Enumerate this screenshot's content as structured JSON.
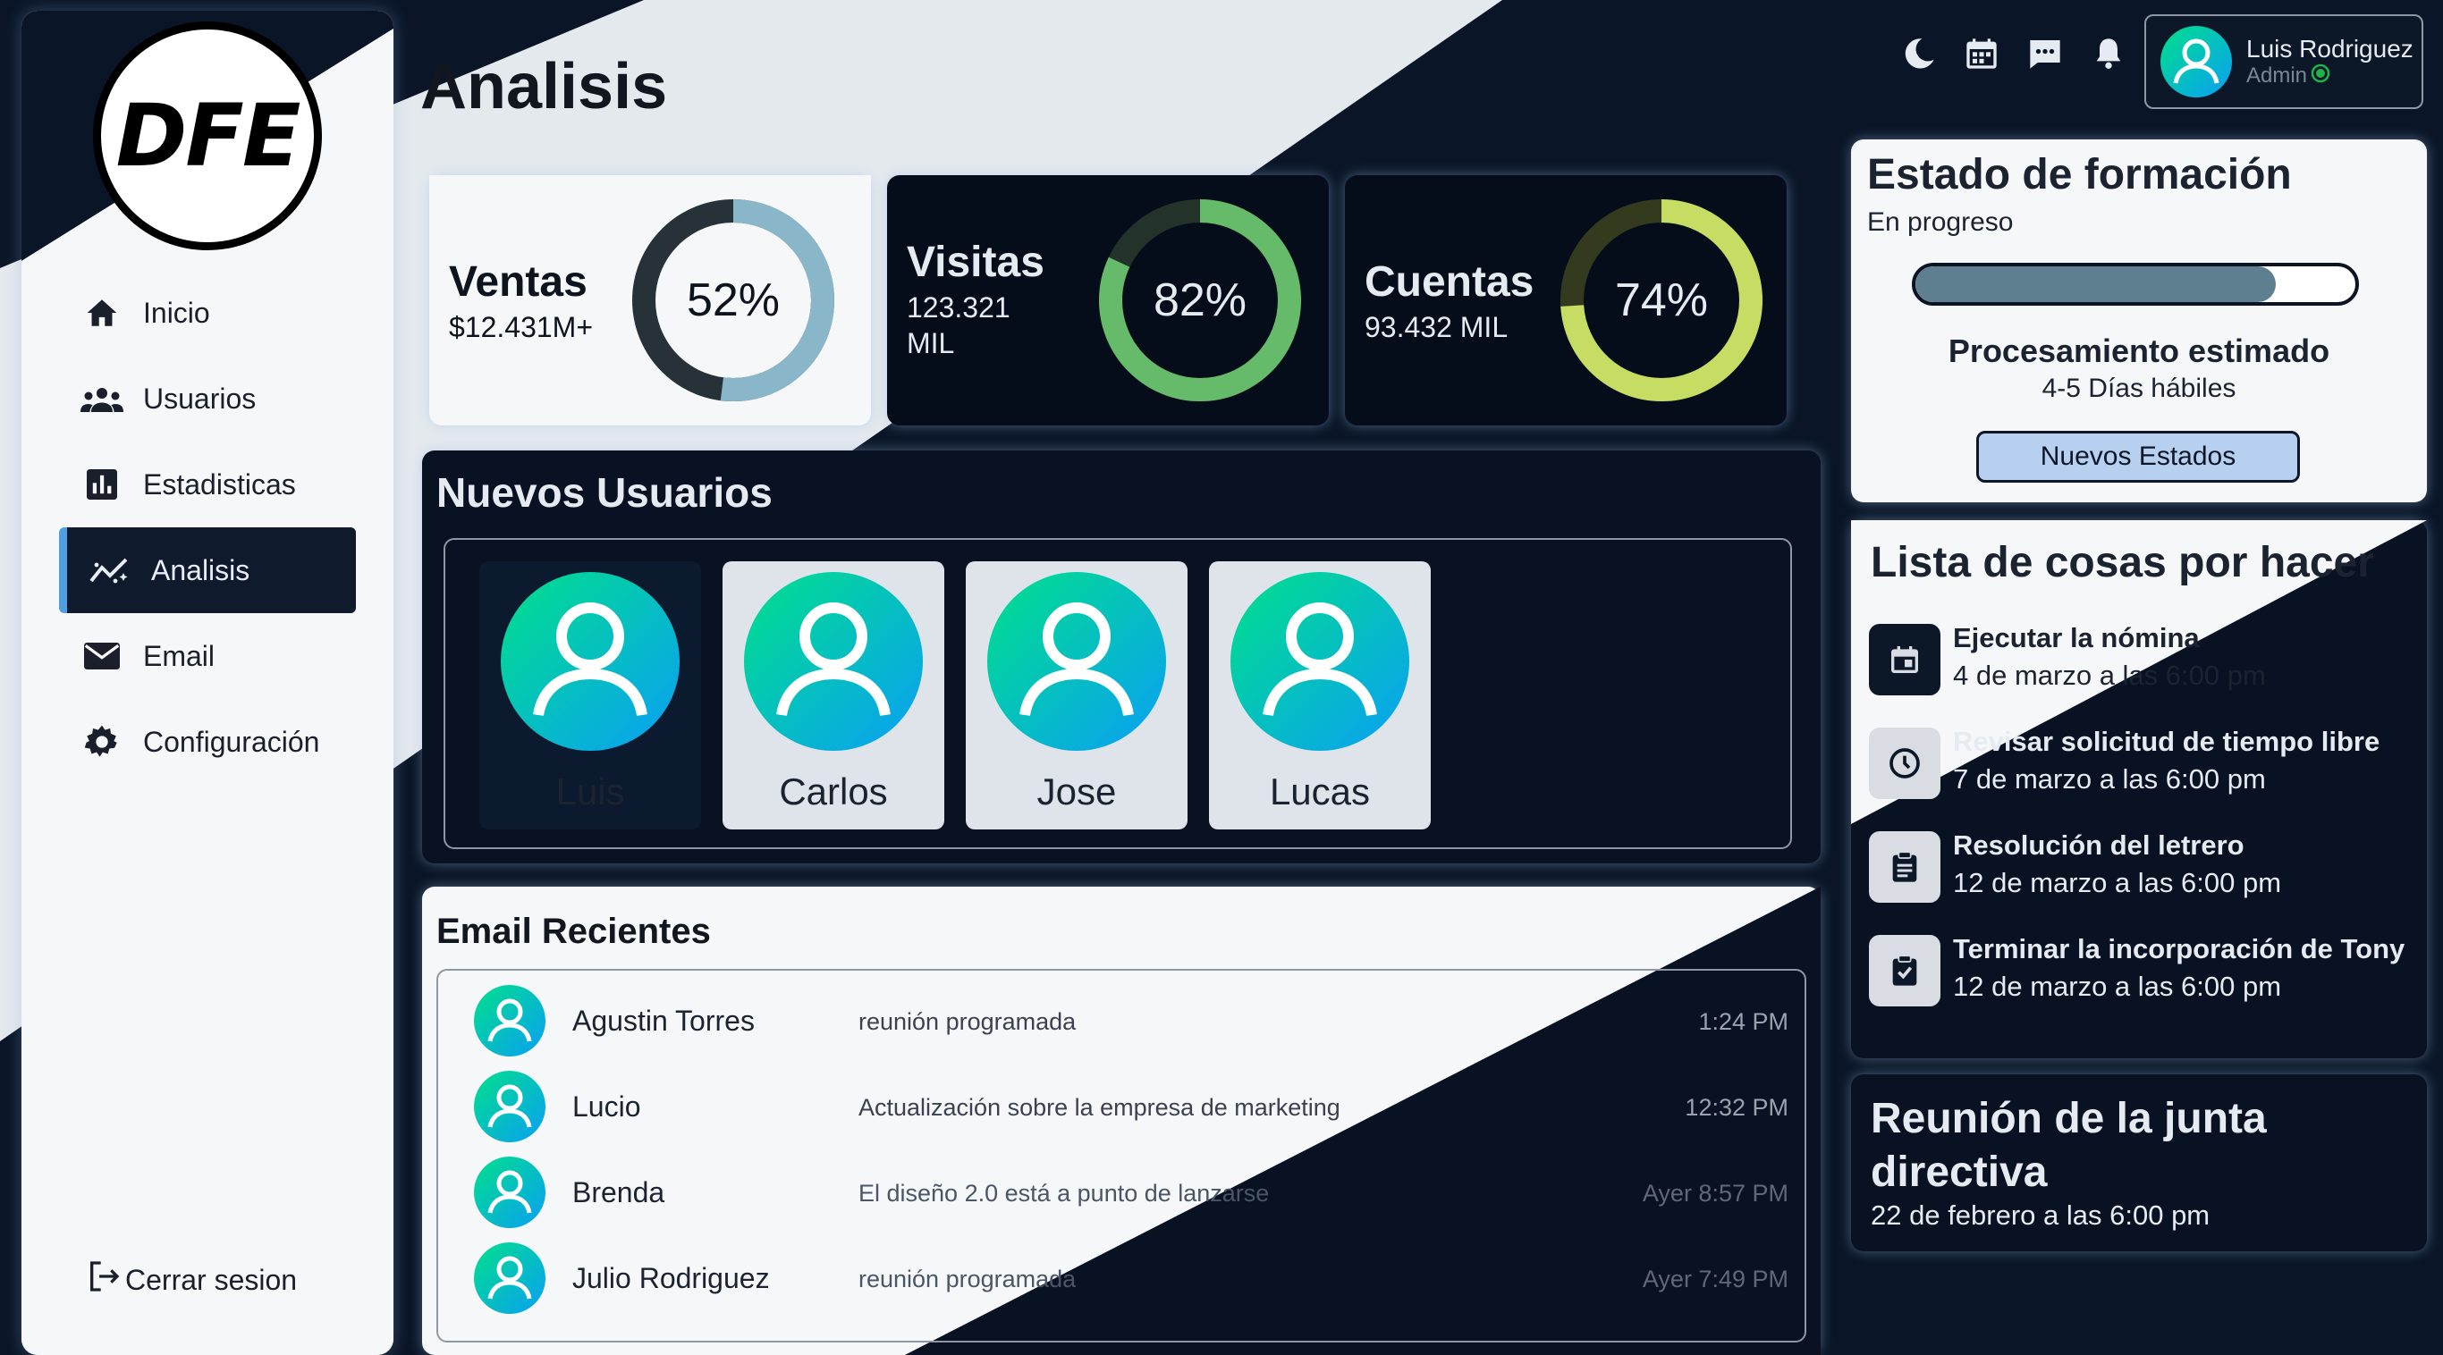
{
  "sidebar": {
    "logo_text": "DFE",
    "items": [
      {
        "label": "Inicio",
        "icon": "home-icon"
      },
      {
        "label": "Usuarios",
        "icon": "users-icon"
      },
      {
        "label": "Estadisticas",
        "icon": "bar-chart-icon"
      },
      {
        "label": "Analisis",
        "icon": "analytics-icon",
        "active": true
      },
      {
        "label": "Email",
        "icon": "mail-icon"
      },
      {
        "label": "Configuración",
        "icon": "gear-icon"
      }
    ],
    "logout_label": "Cerrar sesion"
  },
  "header": {
    "title": "Analisis",
    "icons": [
      "moon-icon",
      "calendar-icon",
      "chat-icon",
      "bell-icon"
    ],
    "user": {
      "name": "Luis Rodriguez",
      "role": "Admin",
      "status_color": "#1fb34a"
    }
  },
  "stats": [
    {
      "label": "Ventas",
      "value": "$12.431M+",
      "percent": 52,
      "percent_label": "52%",
      "color": "#8ab6c9",
      "track": "#263238"
    },
    {
      "label": "Visitas",
      "value_line1": "123.321",
      "value_line2": "MIL",
      "percent": 82,
      "percent_label": "82%",
      "color": "#66bb6a",
      "track": "#24332a"
    },
    {
      "label": "Cuentas",
      "value": "93.432 MIL",
      "percent": 74,
      "percent_label": "74%",
      "color": "#c6dc63",
      "track": "#343a1e"
    }
  ],
  "new_users": {
    "title": "Nuevos Usuarios",
    "users": [
      "Luis",
      "Carlos",
      "Jose",
      "Lucas"
    ]
  },
  "emails": {
    "title": "Email Recientes",
    "rows": [
      {
        "name": "Agustin Torres",
        "subject": "reunión programada",
        "time": "1:24 PM"
      },
      {
        "name": "Lucio",
        "subject": "Actualización sobre la empresa de marketing",
        "time": "12:32 PM"
      },
      {
        "name": "Brenda",
        "subject": "El diseño 2.0 está a punto de lanzarse",
        "time": "Ayer 8:57 PM"
      },
      {
        "name": "Julio Rodriguez",
        "subject": "reunión programada",
        "time": "Ayer 7:49 PM"
      }
    ]
  },
  "training": {
    "title": "Estado de formación",
    "status": "En progreso",
    "progress": 0.82,
    "processing_title": "Procesamiento estimado",
    "processing_time": "4-5 Días hábiles",
    "button_label": "Nuevos Estados"
  },
  "todo": {
    "title": "Lista de cosas por hacer",
    "items": [
      {
        "title": "Ejecutar la nómina",
        "date": "4 de marzo a las 6:00 pm",
        "icon": "calendar-event-icon"
      },
      {
        "title": "Revisar solicitud de tiempo libre",
        "date": "7 de marzo a las 6:00 pm",
        "icon": "clock-icon"
      },
      {
        "title": "Resolución del letrero",
        "date": "12 de marzo a las 6:00 pm",
        "icon": "clipboard-icon"
      },
      {
        "title": "Terminar la incorporación de Tony",
        "date": "12 de marzo a las 6:00 pm",
        "icon": "clipboard-check-icon"
      }
    ]
  },
  "meeting": {
    "title_line1": "Reunión de la junta",
    "title_line2": "directiva",
    "date": "22 de febrero a las 6:00 pm"
  },
  "colors": {
    "dark_bg": "#0a1628",
    "light_bg": "#e4e9ee",
    "accent": "#4f9fe0",
    "avatar_gradient_start": "#00e08a",
    "avatar_gradient_end": "#0a9ff5"
  }
}
